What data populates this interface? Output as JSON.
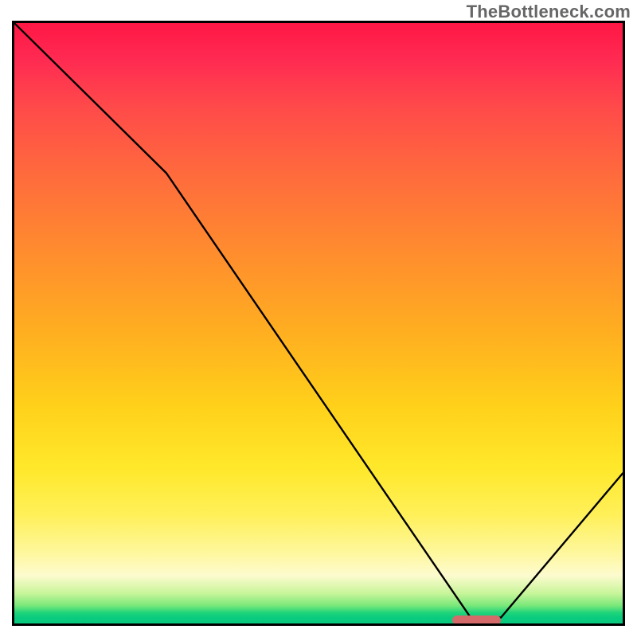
{
  "watermark": "TheBottleneck.com",
  "chart_data": {
    "type": "line",
    "title": "",
    "xlabel": "",
    "ylabel": "",
    "xlim": [
      0,
      100
    ],
    "ylim": [
      0,
      100
    ],
    "grid": false,
    "series": [
      {
        "name": "curve",
        "x": [
          0,
          25,
          75,
          80,
          100
        ],
        "values": [
          100,
          75,
          1,
          1,
          25
        ]
      }
    ],
    "annotations": [
      {
        "name": "min-marker",
        "x_range": [
          72,
          80
        ],
        "y": 0.5
      }
    ],
    "background_gradient": {
      "top": "#ff1744",
      "mid": "#ffd11a",
      "bottom": "#08c97e"
    }
  },
  "plot": {
    "inner_width": 764,
    "inner_height": 754
  },
  "marker": {
    "color": "#d46a6a"
  }
}
